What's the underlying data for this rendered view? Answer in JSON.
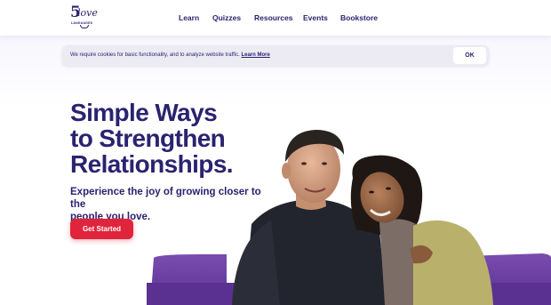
{
  "brand": {
    "logo_text": "5love",
    "logo_sub": "LANGUAGES"
  },
  "nav": [
    {
      "label": "Learn"
    },
    {
      "label": "Quizzes"
    },
    {
      "label": "Resources"
    },
    {
      "label": "Events"
    },
    {
      "label": "Bookstore"
    }
  ],
  "cookie": {
    "message": "We require cookies for basic functionality, and to analyze website traffic.",
    "link": "Learn More",
    "ok_label": "OK"
  },
  "hero": {
    "title_lines": [
      "Simple Ways",
      "to Strengthen",
      "Relationships."
    ],
    "subtitle_lines": [
      "Experience the joy of growing closer to the",
      "people you love."
    ],
    "cta_label": "Get Started"
  },
  "colors": {
    "brand_navy": "#2a2370",
    "cta_red": "#e0243b",
    "sofa_purple": "#6b3fa0",
    "cookie_bg": "#ecebf4"
  }
}
